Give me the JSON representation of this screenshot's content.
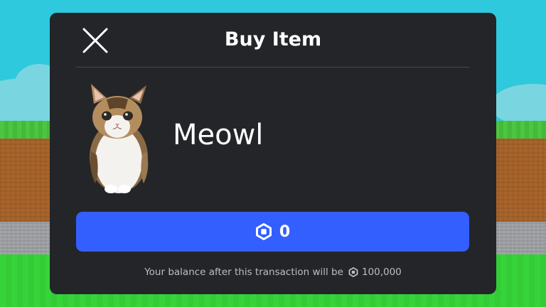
{
  "dialog": {
    "title": "Buy Item",
    "close_icon": "close-icon"
  },
  "item": {
    "name": "Meowl",
    "image": "cat-image"
  },
  "buy_button": {
    "currency_icon": "robux-icon",
    "price": "0",
    "color": "#335fff"
  },
  "balance": {
    "text": "Your balance after this transaction will be",
    "currency_icon": "robux-icon",
    "amount": "100,000"
  },
  "colors": {
    "dialog_bg": "#232529",
    "sky": "#2ec9dc",
    "grass": "#36d43a",
    "dirt": "#a8642a",
    "stone": "#9d9fa3"
  }
}
